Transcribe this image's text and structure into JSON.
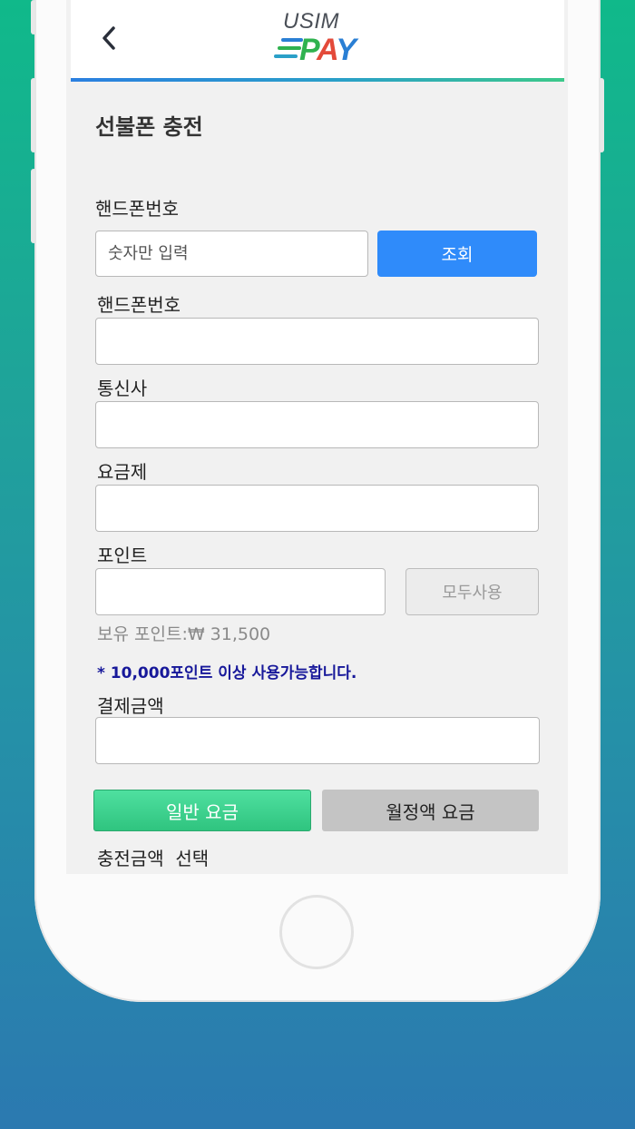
{
  "header": {
    "logo_top": "USIM",
    "logo_pay_p": "P",
    "logo_pay_a": "A",
    "logo_pay_y": "Y"
  },
  "page_title": "선불폰 충전",
  "lookup": {
    "label": "핸드폰번호",
    "placeholder": "숫자만 입력",
    "button": "조회"
  },
  "form": {
    "phone_label": "핸드폰번호",
    "phone_value": "",
    "carrier_label": "통신사",
    "carrier_value": "",
    "plan_label": "요금제",
    "plan_value": "",
    "points_label": "포인트",
    "points_value": "",
    "use_all_button": "모두사용",
    "points_held": "보유 포인트:₩ 31,500",
    "points_notice": "* 10,000포인트 이상 사용가능합니다.",
    "payment_label": "결제금액",
    "payment_value": ""
  },
  "plan_tabs": {
    "general": "일반 요금",
    "monthly": "월정액 요금"
  },
  "charge_amount_label": "충전금액  선택",
  "colors": {
    "accent_blue": "#2f8bfa",
    "accent_green": "#2fc47f",
    "notice_text": "#17189a"
  }
}
